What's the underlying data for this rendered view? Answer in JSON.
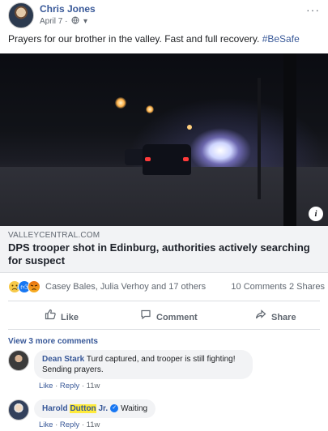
{
  "post": {
    "author": "Chris Jones",
    "date": "April 7 ·",
    "privacy_icon": "globe-icon",
    "more_icon": "ellipsis-icon",
    "text": "Prayers for our brother in the valley. Fast and full recovery.",
    "hashtag": "#BeSafe"
  },
  "link_preview": {
    "info_icon": "i",
    "domain": "VALLEYCENTRAL.COM",
    "headline": "DPS trooper shot in Edinburg, authorities actively searching for suspect"
  },
  "reactions": {
    "emojis": [
      "sad-icon",
      "like-icon",
      "angry-icon"
    ],
    "names": "Casey Bales, Julia Verhoy and 17 others",
    "comments": "10 Comments",
    "shares": "2 Shares"
  },
  "actions": {
    "like": "Like",
    "comment": "Comment",
    "share": "Share"
  },
  "comments": {
    "view_more": "View 3 more comments",
    "items": [
      {
        "name": "Dean Stark",
        "text": "Turd captured, and trooper is still fighting! Sending prayers.",
        "like": "Like",
        "reply": "Reply",
        "time": "11w"
      },
      {
        "name_first": "Harold",
        "name_highlight": "Dutton",
        "name_last": "Jr.",
        "verified_icon": "verified-badge-icon",
        "text": "Waiting",
        "like": "Like",
        "reply": "Reply",
        "time": "11w"
      }
    ]
  },
  "colors": {
    "link_blue": "#385898",
    "meta_gray": "#606770",
    "preview_bg": "#f2f3f5",
    "highlight": "#ffeb3b"
  }
}
